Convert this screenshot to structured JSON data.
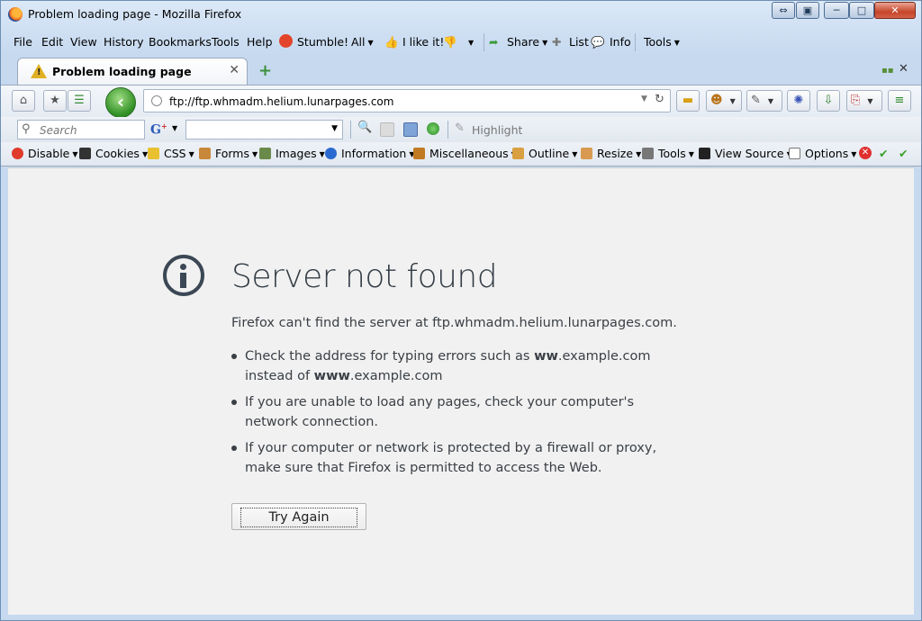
{
  "window": {
    "title": "Problem loading page - Mozilla Firefox"
  },
  "menubar": {
    "items": [
      "File",
      "Edit",
      "View",
      "History",
      "Bookmarks",
      "Tools",
      "Help"
    ],
    "stumble": "Stumble!",
    "all": "All",
    "ilike": "I like it!",
    "share": "Share",
    "list": "List",
    "info": "Info",
    "tools": "Tools"
  },
  "tab": {
    "title": "Problem loading page"
  },
  "navbar": {
    "url": "ftp://ftp.whmadm.helium.lunarpages.com"
  },
  "searchbar": {
    "placeholder": "Search",
    "highlight": "Highlight"
  },
  "devbar": {
    "items": [
      "Disable",
      "Cookies",
      "CSS",
      "Forms",
      "Images",
      "Information",
      "Miscellaneous",
      "Outline",
      "Resize",
      "Tools",
      "View Source",
      "Options"
    ]
  },
  "error": {
    "title": "Server not found",
    "description": "Firefox can't find the server at ftp.whmadm.helium.lunarpages.com.",
    "b1_pre": "Check the address for typing errors such as ",
    "b1_strong1": "ww",
    "b1_mid": ".example.com instead of ",
    "b1_strong2": "www",
    "b1_post": ".example.com",
    "b2": "If you are unable to load any pages, check your computer's network connection.",
    "b3": "If your computer or network is protected by a firewall or proxy, make sure that Firefox is permitted to access the Web.",
    "button": "Try Again"
  },
  "colors": {
    "accent": "#2e8e22",
    "warning": "#e0b024",
    "close": "#c6452a"
  }
}
